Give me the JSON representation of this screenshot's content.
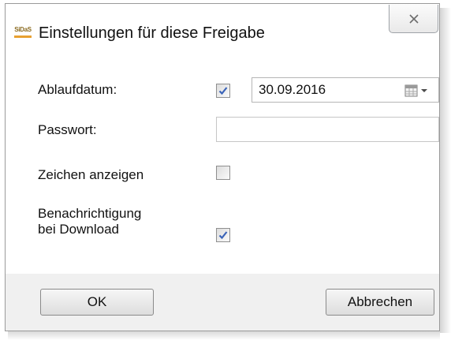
{
  "window": {
    "app_icon_text": "SiDaS",
    "title": "Einstellungen für diese Freigabe",
    "close_icon": "close-icon"
  },
  "form": {
    "expiry": {
      "label": "Ablaufdatum:",
      "checked": true,
      "value": "30.09.2016",
      "picker_icon": "calendar-dropdown-icon"
    },
    "password": {
      "label": "Passwort:",
      "value": ""
    },
    "show_chars": {
      "label": "Zeichen anzeigen",
      "checked": false
    },
    "notify": {
      "label_line1": "Benachrichtigung",
      "label_line2": "bei Download",
      "checked": true
    }
  },
  "buttons": {
    "ok": "OK",
    "cancel": "Abbrechen"
  },
  "colors": {
    "checkmark": "#3a63b8",
    "footer_bg": "#f0f0f0",
    "icon_accent": "#e8a030"
  }
}
